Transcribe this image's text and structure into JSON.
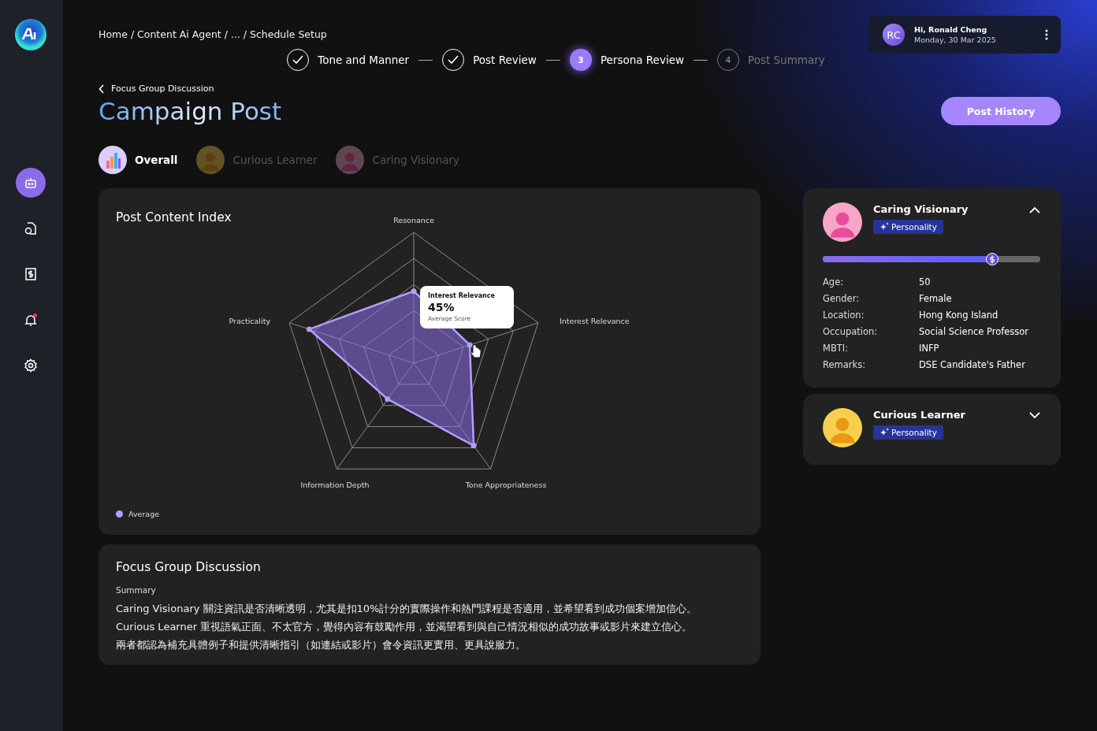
{
  "sidebar": {
    "items": [
      {
        "kind": "robot",
        "selected": true,
        "alert": false
      },
      {
        "kind": "document",
        "selected": false,
        "alert": false
      },
      {
        "kind": "invoice",
        "selected": false,
        "alert": false
      },
      {
        "kind": "bell",
        "selected": false,
        "alert": true
      },
      {
        "kind": "settings",
        "selected": false,
        "alert": false
      }
    ]
  },
  "breadcrumb": "Home  /  Content Ai  Agent  /  ...  / Schedule Setup",
  "user": {
    "initials": "RC",
    "greeting": "Hi, Ronald Cheng",
    "date": "Monday, 30 Mar 2025"
  },
  "steps": [
    {
      "label": "Tone and Manner",
      "kind": "done"
    },
    {
      "label": "Post Review",
      "kind": "done"
    },
    {
      "label": "Persona Review",
      "kind": "current",
      "number": "3"
    },
    {
      "label": "Post Summary",
      "kind": "pending",
      "number": "4"
    }
  ],
  "back_link": "Focus Group Discussion",
  "page_title": "Campaign Post",
  "post_history_button": "Post History",
  "persona_tabs": [
    {
      "label": "Overall",
      "kind": "overall",
      "selected": true
    },
    {
      "label": "Curious Learner",
      "kind": "yellow",
      "selected": false
    },
    {
      "label": "Caring Visionary",
      "kind": "pink",
      "selected": false
    }
  ],
  "chart_card": {
    "title": "Post Content Index",
    "axes": [
      "Resonance",
      "Practicality",
      "Interest Relevance",
      "Information Depth",
      "Tone Appropriateness"
    ],
    "tooltip": {
      "title": "Interest Relevance",
      "value": "45%",
      "caption": "Average Score"
    },
    "legend": {
      "label": "Average",
      "color": "#b59cff"
    }
  },
  "focus_group": {
    "title": "Focus Group Discussion",
    "subtitle": "Summary",
    "lines": [
      "Caring Visionary 關注資訊是否清晰透明，尤其是扣10%計分的實際操作和熱門課程是否適用，並希望看到成功個案增加信心。",
      "Curious Learner 重視語氣正面、不太官方，覺得內容有鼓勵作用，並渴望看到與自己情況相似的成功故事或影片來建立信心。",
      "兩者都認為補充具體例子和提供清晰指引（如連結或影片）會令資訊更實用、更具說服力。"
    ]
  },
  "personas": [
    {
      "name": "Caring Visionary",
      "kind": "pink",
      "tag": "Personality",
      "expanded": true,
      "level": 0.78,
      "details": [
        {
          "label": "Age:",
          "value": "50"
        },
        {
          "label": "Gender:",
          "value": "Female"
        },
        {
          "label": "Location:",
          "value": "Hong Kong Island"
        },
        {
          "label": "Occupation:",
          "value": "Social Science Professor"
        },
        {
          "label": "MBTI:",
          "value": "INFP"
        },
        {
          "label": "Remarks:",
          "value": "DSE Candidate's Father"
        }
      ]
    },
    {
      "name": "Curious Learner",
      "kind": "yellow",
      "tag": "Personality",
      "expanded": false
    }
  ]
}
